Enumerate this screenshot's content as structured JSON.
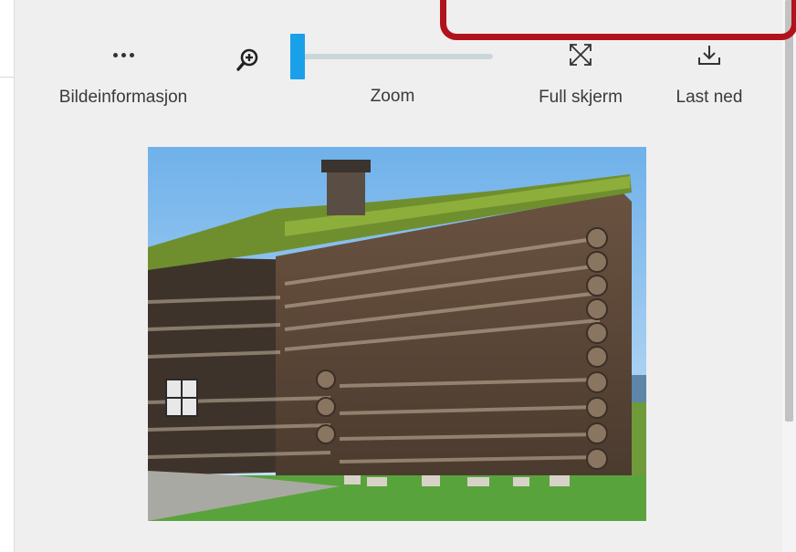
{
  "toolbar": {
    "info_label": "Bildeinformasjon",
    "zoom_label": "Zoom",
    "fullscreen_label": "Full skjerm",
    "download_label": "Last ned"
  },
  "zoom": {
    "level": 0.0
  },
  "icons": {
    "info": "more-dots-icon",
    "zoom": "zoom-in-icon",
    "fullscreen": "fullscreen-icon",
    "download": "download-icon"
  },
  "colors": {
    "accent": "#1aa0e8",
    "highlight": "#b0131b",
    "panel": "#efefef"
  }
}
